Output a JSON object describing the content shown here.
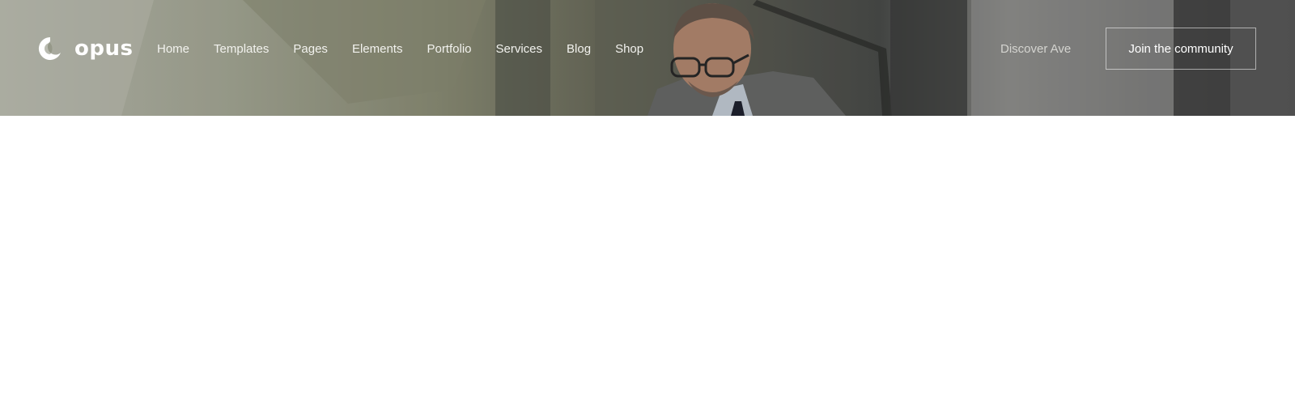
{
  "brand": {
    "name": "opus",
    "logo_icon": "swirl-logo-icon"
  },
  "nav": {
    "items": [
      {
        "label": "Home"
      },
      {
        "label": "Templates"
      },
      {
        "label": "Pages"
      },
      {
        "label": "Elements"
      },
      {
        "label": "Portfolio"
      },
      {
        "label": "Services"
      },
      {
        "label": "Blog"
      },
      {
        "label": "Shop"
      }
    ],
    "secondary_link": "Discover Ave",
    "cta_label": "Join the community"
  },
  "hero": {
    "image": "man-in-suit-with-glasses-photo"
  },
  "colors": {
    "nav_text": "#f2f2ee",
    "muted_link": "#d4d4d0",
    "page_bg": "#ffffff"
  }
}
